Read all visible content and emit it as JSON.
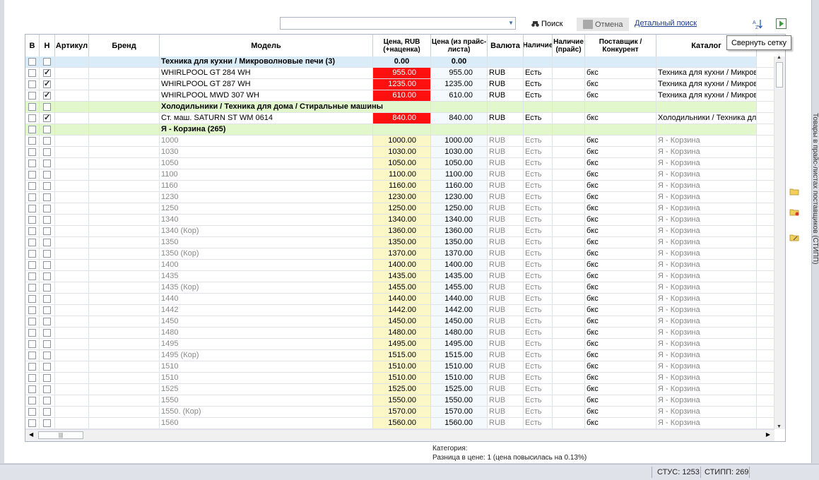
{
  "toolbar": {
    "search_value": "",
    "search_label": "Поиск",
    "cancel_label": "Отмена",
    "advanced_link": "Детальный поиск",
    "tooltip": "Свернуть сетку"
  },
  "side_panel_label": "Товары в прайс-листах поставщиков (СТИПП)",
  "columns": [
    {
      "key": "b",
      "label": "В"
    },
    {
      "key": "n",
      "label": "Н"
    },
    {
      "key": "art",
      "label": "Артикул"
    },
    {
      "key": "brand",
      "label": "Бренд"
    },
    {
      "key": "model",
      "label": "Модель"
    },
    {
      "key": "price",
      "label": "Цена, RUB (+наценка)"
    },
    {
      "key": "price2",
      "label": "Цена (из прайс-листа)"
    },
    {
      "key": "cur",
      "label": "Валюта"
    },
    {
      "key": "avail",
      "label": "Наличие"
    },
    {
      "key": "avail2",
      "label": "Наличие (прайс)"
    },
    {
      "key": "supplier",
      "label": "Поставщик / Конкурент"
    },
    {
      "key": "catalog",
      "label": "Каталог"
    }
  ],
  "rows": [
    {
      "type": "group",
      "style": "blue",
      "title": "Техника для кухни / Микроволновые печи (3)",
      "price": "0.00",
      "price2": "0.00",
      "n": false
    },
    {
      "type": "item",
      "b": false,
      "n": true,
      "model": "WHIRLPOOL GT 284 WH",
      "price": "955.00",
      "price2": "955.00",
      "cur": "RUB",
      "avail": "Есть",
      "supplier": "бкс",
      "catalog": "Техника для кухни / Микроволновые печи",
      "hl": "red",
      "dim": false
    },
    {
      "type": "item",
      "b": false,
      "n": true,
      "model": "WHIRLPOOL GT 287 WH",
      "price": "1235.00",
      "price2": "1235.00",
      "cur": "RUB",
      "avail": "Есть",
      "supplier": "бкс",
      "catalog": "Техника для кухни / Микроволновые печи",
      "hl": "red",
      "dim": false
    },
    {
      "type": "item",
      "b": false,
      "n": true,
      "model": "WHIRLPOOL MWD 307 WH",
      "price": "610.00",
      "price2": "610.00",
      "cur": "RUB",
      "avail": "Есть",
      "supplier": "бкс",
      "catalog": "Техника для кухни / Микроволновые печи",
      "hl": "red",
      "dim": false
    },
    {
      "type": "group",
      "style": "green",
      "title": "Холодильники / Техника для дома / Стиральные машины",
      "price": "",
      "price2": "",
      "n": false
    },
    {
      "type": "item",
      "b": false,
      "n": true,
      "model": "Ст. маш. SATURN ST WM 0614",
      "price": "840.00",
      "price2": "840.00",
      "cur": "RUB",
      "avail": "Есть",
      "supplier": "бкс",
      "catalog": "Холодильники / Техника для дома",
      "hl": "red",
      "dim": false
    },
    {
      "type": "group",
      "style": "green",
      "title": "Я - Корзина (265)",
      "price": "",
      "price2": "",
      "n": false
    },
    {
      "type": "item",
      "b": false,
      "n": false,
      "model": "1000",
      "price": "1000.00",
      "price2": "1000.00",
      "cur": "RUB",
      "avail": "Есть",
      "supplier": "бкс",
      "catalog": "Я - Корзина",
      "hl": "yellow",
      "dim": true
    },
    {
      "type": "item",
      "b": false,
      "n": false,
      "model": "1030",
      "price": "1030.00",
      "price2": "1030.00",
      "cur": "RUB",
      "avail": "Есть",
      "supplier": "бкс",
      "catalog": "Я - Корзина",
      "hl": "yellow",
      "dim": true
    },
    {
      "type": "item",
      "b": false,
      "n": false,
      "model": "1050",
      "price": "1050.00",
      "price2": "1050.00",
      "cur": "RUB",
      "avail": "Есть",
      "supplier": "бкс",
      "catalog": "Я - Корзина",
      "hl": "yellow",
      "dim": true
    },
    {
      "type": "item",
      "b": false,
      "n": false,
      "model": "1100",
      "price": "1100.00",
      "price2": "1100.00",
      "cur": "RUB",
      "avail": "Есть",
      "supplier": "бкс",
      "catalog": "Я - Корзина",
      "hl": "yellow",
      "dim": true
    },
    {
      "type": "item",
      "b": false,
      "n": false,
      "model": "1160",
      "price": "1160.00",
      "price2": "1160.00",
      "cur": "RUB",
      "avail": "Есть",
      "supplier": "бкс",
      "catalog": "Я - Корзина",
      "hl": "yellow",
      "dim": true
    },
    {
      "type": "item",
      "b": false,
      "n": false,
      "model": "1230",
      "price": "1230.00",
      "price2": "1230.00",
      "cur": "RUB",
      "avail": "Есть",
      "supplier": "бкс",
      "catalog": "Я - Корзина",
      "hl": "yellow",
      "dim": true
    },
    {
      "type": "item",
      "b": false,
      "n": false,
      "model": "1250",
      "price": "1250.00",
      "price2": "1250.00",
      "cur": "RUB",
      "avail": "Есть",
      "supplier": "бкс",
      "catalog": "Я - Корзина",
      "hl": "yellow",
      "dim": true
    },
    {
      "type": "item",
      "b": false,
      "n": false,
      "model": "1340",
      "price": "1340.00",
      "price2": "1340.00",
      "cur": "RUB",
      "avail": "Есть",
      "supplier": "бкс",
      "catalog": "Я - Корзина",
      "hl": "yellow",
      "dim": true
    },
    {
      "type": "item",
      "b": false,
      "n": false,
      "model": "1340 (Кор)",
      "price": "1360.00",
      "price2": "1360.00",
      "cur": "RUB",
      "avail": "Есть",
      "supplier": "бкс",
      "catalog": "Я - Корзина",
      "hl": "yellow",
      "dim": true
    },
    {
      "type": "item",
      "b": false,
      "n": false,
      "model": "1350",
      "price": "1350.00",
      "price2": "1350.00",
      "cur": "RUB",
      "avail": "Есть",
      "supplier": "бкс",
      "catalog": "Я - Корзина",
      "hl": "yellow",
      "dim": true
    },
    {
      "type": "item",
      "b": false,
      "n": false,
      "model": "1350 (Кор)",
      "price": "1370.00",
      "price2": "1370.00",
      "cur": "RUB",
      "avail": "Есть",
      "supplier": "бкс",
      "catalog": "Я - Корзина",
      "hl": "yellow",
      "dim": true
    },
    {
      "type": "item",
      "b": false,
      "n": false,
      "model": "1400",
      "price": "1400.00",
      "price2": "1400.00",
      "cur": "RUB",
      "avail": "Есть",
      "supplier": "бкс",
      "catalog": "Я - Корзина",
      "hl": "yellow",
      "dim": true
    },
    {
      "type": "item",
      "b": false,
      "n": false,
      "model": "1435",
      "price": "1435.00",
      "price2": "1435.00",
      "cur": "RUB",
      "avail": "Есть",
      "supplier": "бкс",
      "catalog": "Я - Корзина",
      "hl": "yellow",
      "dim": true
    },
    {
      "type": "item",
      "b": false,
      "n": false,
      "model": "1435 (Кор)",
      "price": "1455.00",
      "price2": "1455.00",
      "cur": "RUB",
      "avail": "Есть",
      "supplier": "бкс",
      "catalog": "Я - Корзина",
      "hl": "yellow",
      "dim": true
    },
    {
      "type": "item",
      "b": false,
      "n": false,
      "model": "1440",
      "price": "1440.00",
      "price2": "1440.00",
      "cur": "RUB",
      "avail": "Есть",
      "supplier": "бкс",
      "catalog": "Я - Корзина",
      "hl": "yellow",
      "dim": true
    },
    {
      "type": "item",
      "b": false,
      "n": false,
      "model": "1442",
      "price": "1442.00",
      "price2": "1442.00",
      "cur": "RUB",
      "avail": "Есть",
      "supplier": "бкс",
      "catalog": "Я - Корзина",
      "hl": "yellow",
      "dim": true
    },
    {
      "type": "item",
      "b": false,
      "n": false,
      "model": "1450",
      "price": "1450.00",
      "price2": "1450.00",
      "cur": "RUB",
      "avail": "Есть",
      "supplier": "бкс",
      "catalog": "Я - Корзина",
      "hl": "yellow",
      "dim": true
    },
    {
      "type": "item",
      "b": false,
      "n": false,
      "model": "1480",
      "price": "1480.00",
      "price2": "1480.00",
      "cur": "RUB",
      "avail": "Есть",
      "supplier": "бкс",
      "catalog": "Я - Корзина",
      "hl": "yellow",
      "dim": true
    },
    {
      "type": "item",
      "b": false,
      "n": false,
      "model": "1495",
      "price": "1495.00",
      "price2": "1495.00",
      "cur": "RUB",
      "avail": "Есть",
      "supplier": "бкс",
      "catalog": "Я - Корзина",
      "hl": "yellow",
      "dim": true
    },
    {
      "type": "item",
      "b": false,
      "n": false,
      "model": "1495 (Кор)",
      "price": "1515.00",
      "price2": "1515.00",
      "cur": "RUB",
      "avail": "Есть",
      "supplier": "бкс",
      "catalog": "Я - Корзина",
      "hl": "yellow",
      "dim": true
    },
    {
      "type": "item",
      "b": false,
      "n": false,
      "model": "1510",
      "price": "1510.00",
      "price2": "1510.00",
      "cur": "RUB",
      "avail": "Есть",
      "supplier": "бкс",
      "catalog": "Я - Корзина",
      "hl": "yellow",
      "dim": true
    },
    {
      "type": "item",
      "b": false,
      "n": false,
      "model": "1510",
      "price": "1510.00",
      "price2": "1510.00",
      "cur": "RUB",
      "avail": "Есть",
      "supplier": "бкс",
      "catalog": "Я - Корзина",
      "hl": "yellow",
      "dim": true
    },
    {
      "type": "item",
      "b": false,
      "n": false,
      "model": "1525",
      "price": "1525.00",
      "price2": "1525.00",
      "cur": "RUB",
      "avail": "Есть",
      "supplier": "бкс",
      "catalog": "Я - Корзина",
      "hl": "yellow",
      "dim": true
    },
    {
      "type": "item",
      "b": false,
      "n": false,
      "model": "1550",
      "price": "1550.00",
      "price2": "1550.00",
      "cur": "RUB",
      "avail": "Есть",
      "supplier": "бкс",
      "catalog": "Я - Корзина",
      "hl": "yellow",
      "dim": true
    },
    {
      "type": "item",
      "b": false,
      "n": false,
      "model": "1550. (Кор)",
      "price": "1570.00",
      "price2": "1570.00",
      "cur": "RUB",
      "avail": "Есть",
      "supplier": "бкс",
      "catalog": "Я - Корзина",
      "hl": "yellow",
      "dim": true
    },
    {
      "type": "item",
      "b": false,
      "n": false,
      "model": "1560",
      "price": "1560.00",
      "price2": "1560.00",
      "cur": "RUB",
      "avail": "Есть",
      "supplier": "бкс",
      "catalog": "Я - Корзина",
      "hl": "yellow",
      "dim": true
    }
  ],
  "info": {
    "category_label": "Категория:",
    "diff_text": "Разница в цене: 1  (цена повысилась на 0.13%)"
  },
  "status": {
    "stus": "СТУС: 1253",
    "stipp": "СТИПП: 269"
  },
  "colors": {
    "price_highlight_red": "#ff1010",
    "price_highlight_yellow": "#fbf7c7",
    "group_blue": "#d9ecf8",
    "group_green": "#e3f7cc"
  }
}
